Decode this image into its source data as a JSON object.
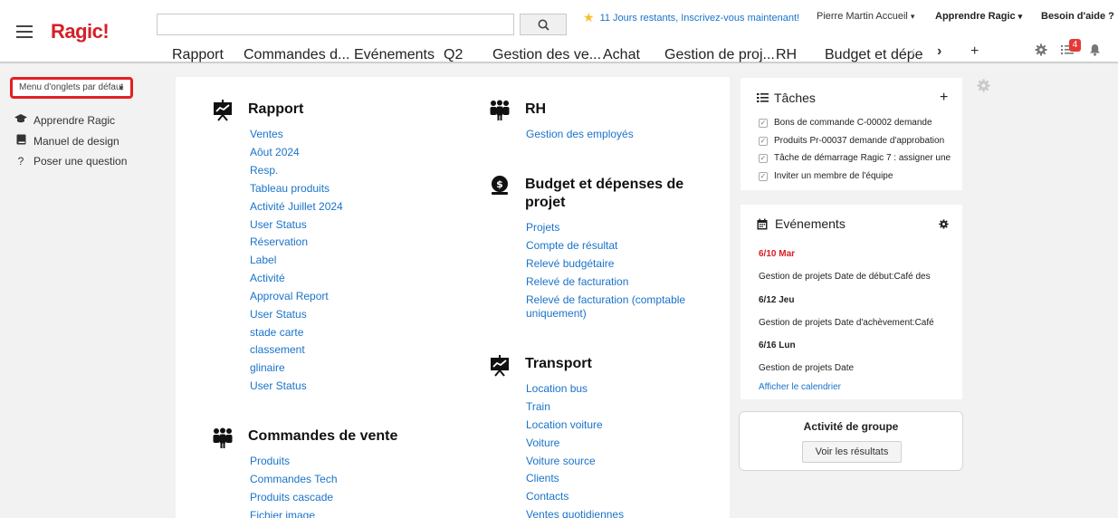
{
  "header": {
    "logo": "Ragic!",
    "search_placeholder": "",
    "trial_text": "11 Jours restants, Inscrivez-vous maintenant!",
    "user_menu": "Pierre Martin Accueil",
    "learn_menu": "Apprendre Ragic",
    "help_menu": "Besoin d'aide ?",
    "notification_count": "4",
    "tabs": [
      "Rapport",
      "Commandes d...",
      "Evénements",
      "Q2",
      "Gestion des ve...",
      "Achat",
      "Gestion de proj...",
      "RH",
      "Budget et dépe"
    ],
    "add_tab": "+"
  },
  "sidebar": {
    "tab_menu": "Menu d'onglets par défaut",
    "links": [
      {
        "label": "Apprendre Ragic",
        "icon": "graduation-cap-icon"
      },
      {
        "label": "Manuel de design",
        "icon": "book-icon"
      },
      {
        "label": "Poser une question",
        "icon": "question-icon"
      }
    ]
  },
  "main": {
    "sections": [
      {
        "title": "Rapport",
        "icon": "presentation-chart-icon",
        "links": [
          "Ventes",
          "Aôut 2024",
          "Resp.",
          "Tableau produits",
          "Activité Juillet 2024",
          "User Status",
          "Réservation",
          "Label",
          "Activité",
          "Approval Report",
          "User Status",
          "stade carte",
          "classement",
          "glinaire",
          "User Status"
        ]
      },
      {
        "title": "Commandes de vente",
        "icon": "people-group-icon",
        "links": [
          "Produits",
          "Commandes Tech",
          "Produits cascade",
          "Fichier image"
        ]
      },
      {
        "title": "RH",
        "icon": "people-group-icon",
        "links": [
          "Gestion des employés"
        ]
      },
      {
        "title": "Budget et dépenses de projet",
        "icon": "money-bag-icon",
        "links": [
          "Projets",
          "Compte de résultat",
          "Relevé budgétaire",
          "Relevé de facturation",
          "Relevé de facturation (comptable uniquement)"
        ]
      },
      {
        "title": "Transport",
        "icon": "presentation-chart-icon",
        "links": [
          "Location bus",
          "Train",
          "Location voiture",
          "Voiture",
          "Voiture source",
          "Clients",
          "Contacts",
          "Ventes quotidiennes"
        ]
      }
    ]
  },
  "tasks": {
    "title": "Tâches",
    "add": "+",
    "items": [
      "Bons de commande C-00002 demande",
      "Produits Pr-00037 demande d'approbation",
      "Tâche de démarrage Ragic 7 : assigner une",
      "Inviter un membre de l'équipe"
    ]
  },
  "events": {
    "title": "Evénements",
    "entries": [
      {
        "date": "6/10 Mar",
        "text": "Gestion de projets Date de début:Café des",
        "highlight": true
      },
      {
        "date": "6/12 Jeu",
        "text": "Gestion de projets Date d'achèvement:Café",
        "highlight": false
      },
      {
        "date": "6/16 Lun",
        "text": "Gestion de projets Date",
        "highlight": false
      }
    ],
    "calendar_link": "Afficher le calendrier"
  },
  "group_activity": {
    "title": "Activité de groupe",
    "button": "Voir les résultats"
  },
  "colors": {
    "brand": "#d61f26",
    "link": "#1a73c9",
    "highlight_border": "#e32021"
  }
}
